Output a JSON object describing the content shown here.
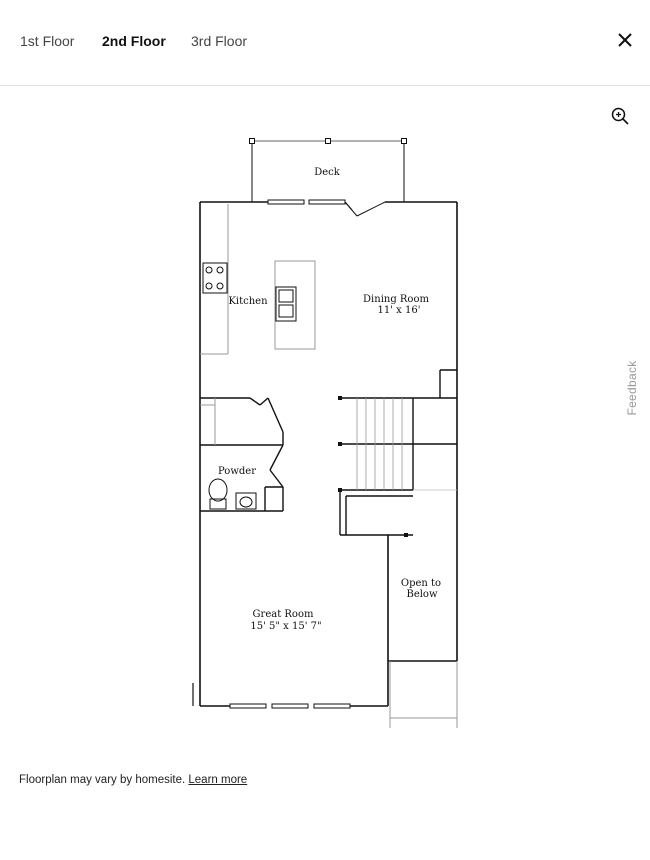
{
  "tabs": [
    {
      "label": "1st Floor",
      "active": false
    },
    {
      "label": "2nd Floor",
      "active": true
    },
    {
      "label": "3rd Floor",
      "active": false
    }
  ],
  "icons": {
    "close": "close-icon",
    "zoom": "zoom-in-icon"
  },
  "feedback_label": "Feedback",
  "floorplan": {
    "rooms": {
      "deck": "Deck",
      "kitchen": "Kitchen",
      "dining": {
        "name": "Dining Room",
        "size": "11' x 16'"
      },
      "powder": "Powder",
      "great": {
        "name": "Great Room",
        "size": "15' 5\" x 15' 7\""
      },
      "open_below": {
        "line1": "Open to",
        "line2": "Below"
      }
    }
  },
  "footer": {
    "disclaimer": "Floorplan may vary by homesite.",
    "link": "Learn more"
  },
  "colors": {
    "text": "#111111",
    "muted": "#999999",
    "divider": "#e2e2e2"
  }
}
